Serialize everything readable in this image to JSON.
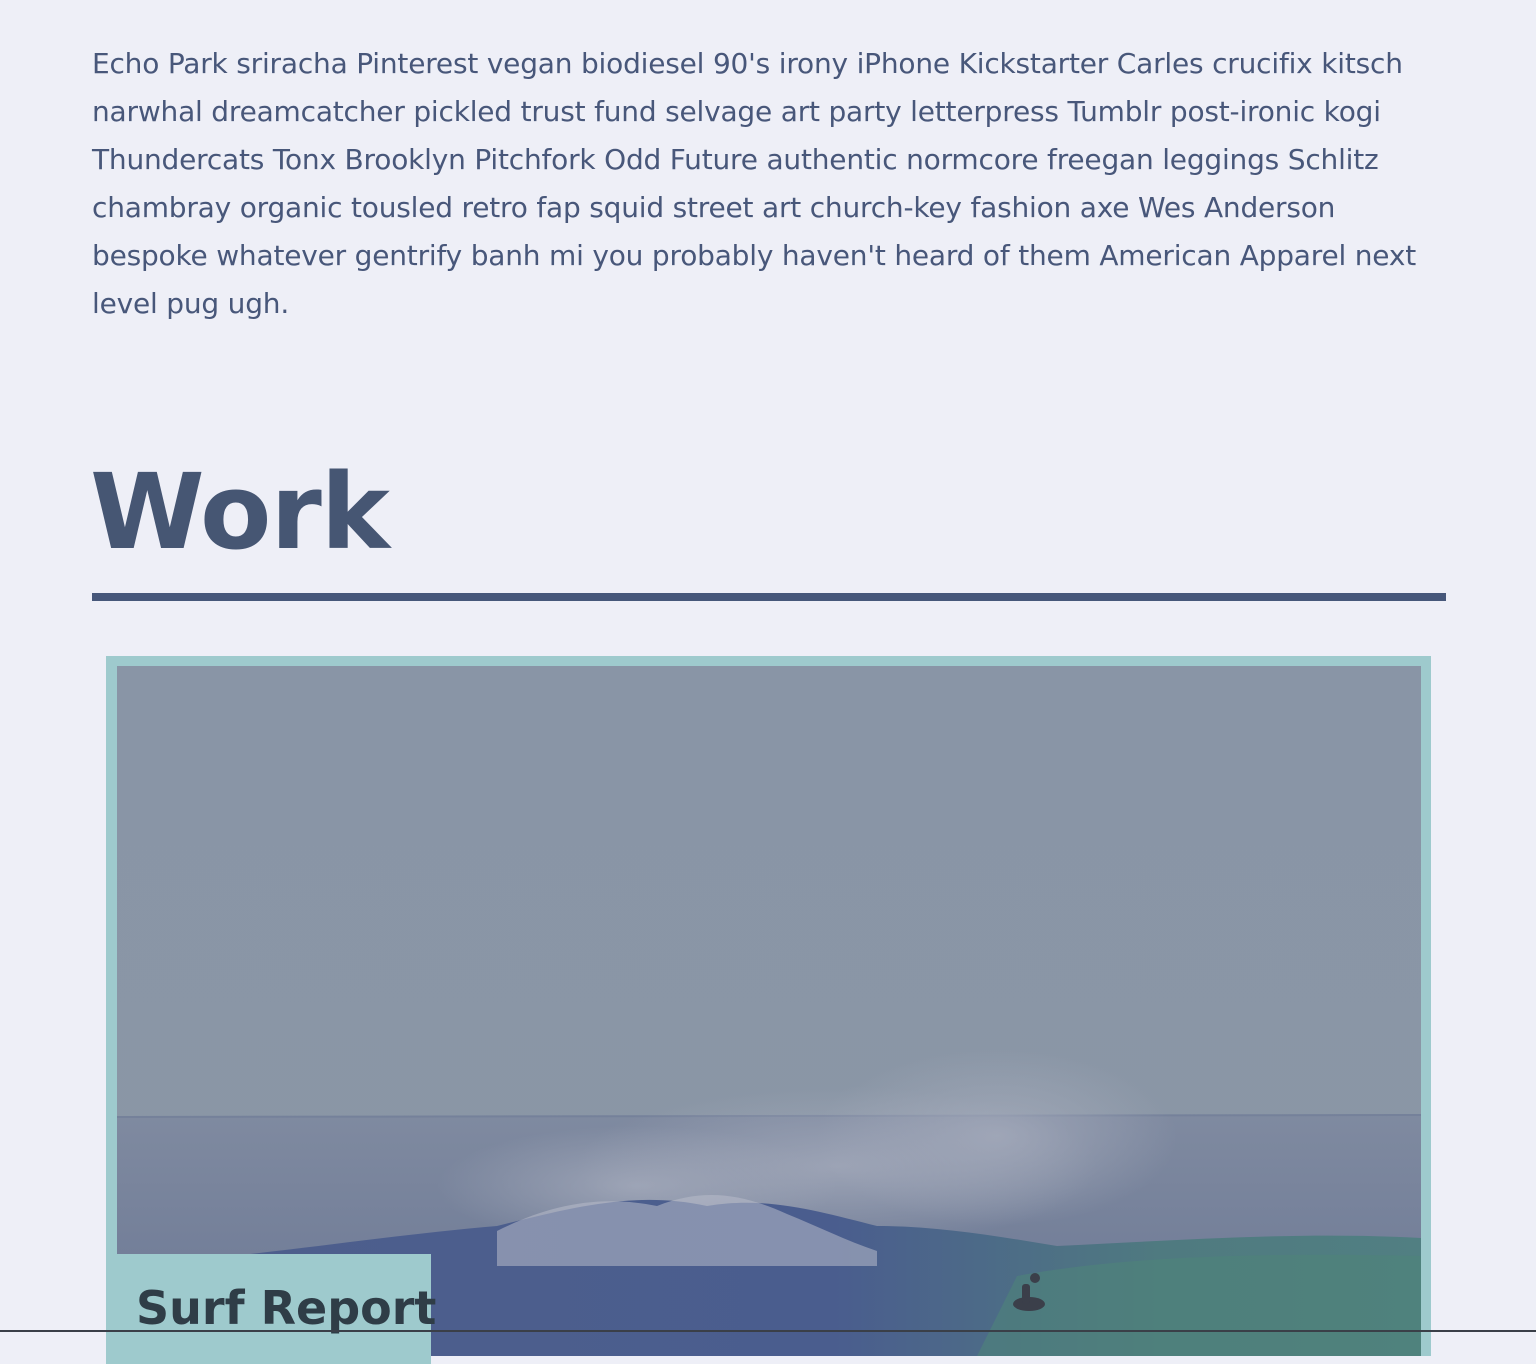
{
  "intro": {
    "text": "Echo Park sriracha Pinterest vegan biodiesel 90's irony iPhone Kickstarter Carles crucifix kitsch narwhal dreamcatcher pickled trust fund selvage art party letterpress Tumblr post-ironic kogi Thundercats Tonx Brooklyn Pitchfork Odd Future authentic normcore freegan leggings Schlitz chambray organic tousled retro fap squid street art church-key fashion axe Wes Anderson bespoke whatever gentrify banh mi you probably haven't heard of them American Apparel next level pug ugh."
  },
  "work": {
    "title": "Work",
    "items": [
      {
        "title": "Surf Report",
        "image": "surfer-on-wave-photo"
      }
    ]
  },
  "colors": {
    "background": "#eeeff7",
    "text": "#48577a",
    "heading": "#465673",
    "divider": "#46577a",
    "card_frame": "#9ecacd",
    "card_label_text": "#2f3d47",
    "image_overlay": "#8a95a5"
  }
}
